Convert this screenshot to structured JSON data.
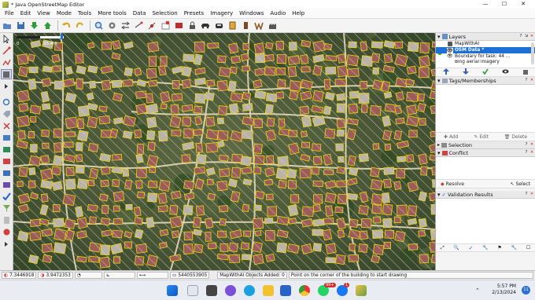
{
  "window": {
    "title": "* Java OpenStreetMap Editor",
    "minimize": "—",
    "maximize": "☐",
    "close": "✕"
  },
  "menu": [
    "File",
    "Edit",
    "View",
    "Mode",
    "Tools",
    "More tools",
    "Data",
    "Selection",
    "Presets",
    "Imagery",
    "Windows",
    "Audio",
    "Help"
  ],
  "toolbar_icons": [
    "open-icon",
    "save-icon",
    "download-icon",
    "upload-icon",
    "undo-icon",
    "redo-icon",
    "zoom-icon",
    "preferences-icon",
    "split-icon",
    "move-icon",
    "add-node-icon",
    "new-layer-icon",
    "warning-icon",
    "lock-icon",
    "car-icon",
    "car-front-icon",
    "info-sign-icon",
    "pen-icon",
    "w-icon",
    "building-icon"
  ],
  "map": {
    "scale_label": "0",
    "scale_value": "35.4 ft",
    "colors": {
      "highlight": "#f2d40c",
      "road": "#e6d9b8",
      "building": "#9b5d55",
      "ground": "#4b5d36",
      "hatch": "#d9d9c8"
    }
  },
  "layers_panel": {
    "title": "Layers",
    "layers": [
      {
        "name": "MapWithAI",
        "selected": false
      },
      {
        "name": "OSM Data *",
        "selected": true
      },
      {
        "name": "Boundary for task: 44 ...",
        "selected": false
      },
      {
        "name": "Bing aerial imagery",
        "selected": false
      }
    ]
  },
  "tags_panel": {
    "title": "Tags/Memberships",
    "add": "Add",
    "edit": "Edit",
    "delete": "Delete"
  },
  "selection_panel": {
    "title": "Selection"
  },
  "conflict_panel": {
    "title": "Conflict",
    "resolve": "Resolve",
    "select": "Select"
  },
  "validation_panel": {
    "title": "Validation Results"
  },
  "status": {
    "latitude": "7.3446918",
    "longitude": "3.9472353",
    "heading": "",
    "length": "",
    "area": "",
    "way_id": "5440553905",
    "mapwithai": "MapWithAI Objects Added: 0",
    "hint": "Point on the corner of the building to start drawing"
  },
  "taskbar": {
    "time": "5:57 PM",
    "date": "2/13/2024",
    "notifications": "11",
    "whatsapp_badge": "99+",
    "messenger_badge": "1"
  }
}
